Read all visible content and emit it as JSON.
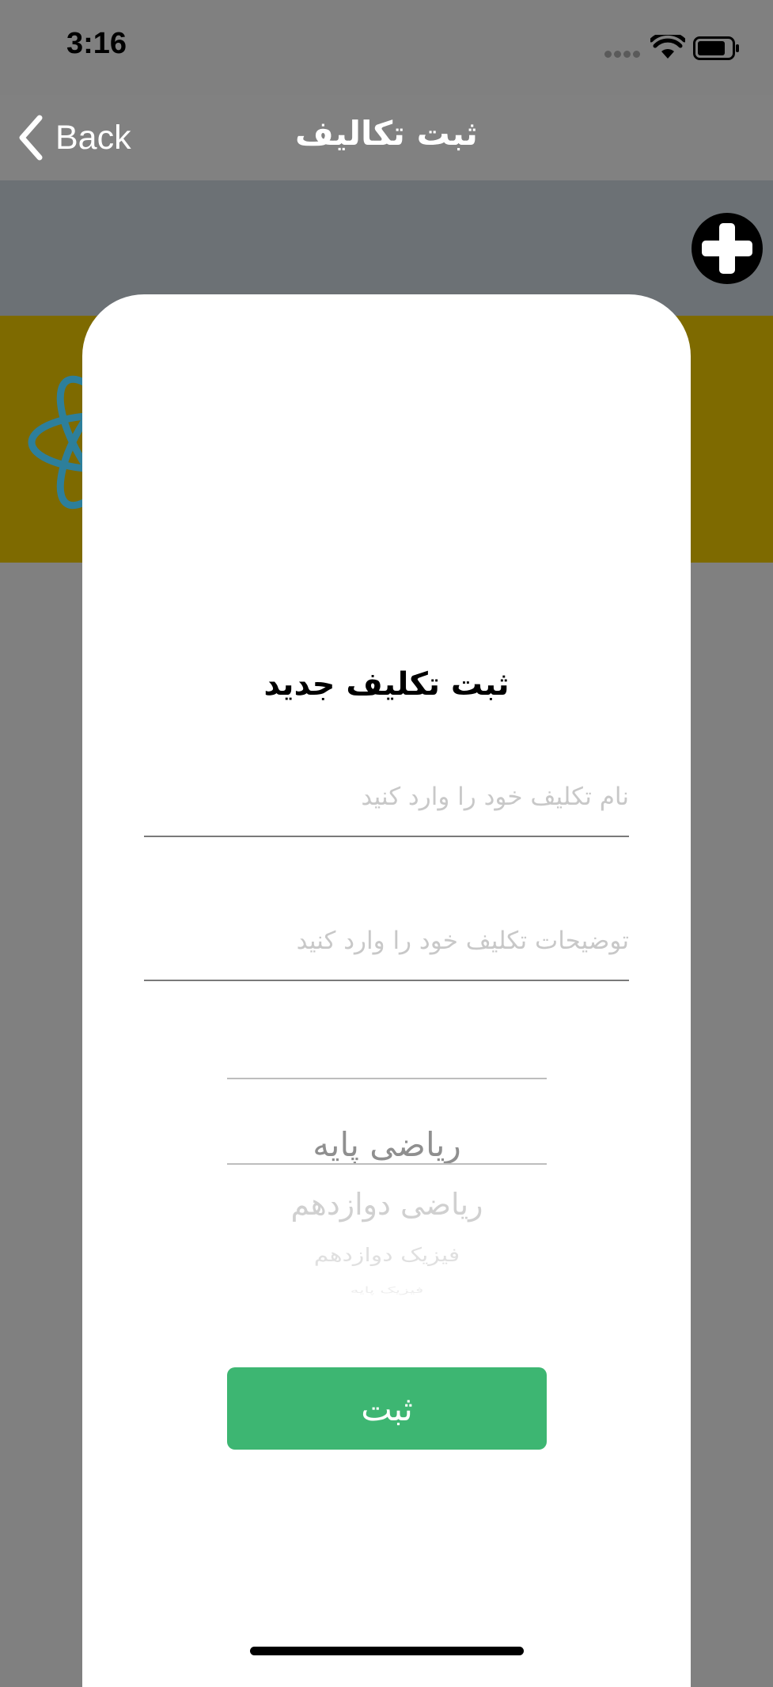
{
  "status_bar": {
    "time": "3:16"
  },
  "nav": {
    "back_label": "Back",
    "title": "ثبت تکالیف"
  },
  "modal": {
    "title": "ثبت تکلیف جدید",
    "name_field": {
      "placeholder": "نام تکلیف خود را وارد کنید",
      "value": ""
    },
    "description_field": {
      "placeholder": "توضیحات تکلیف خود را وارد کنید",
      "value": ""
    },
    "subject_picker": {
      "selected": "ریاضی پایه",
      "options": [
        "ریاضی دوازدهم",
        "فیزیک دوازدهم",
        "فیزیک پایه"
      ]
    },
    "submit_label": "ثبت"
  },
  "colors": {
    "overlay": "#808080",
    "banner": "#7e6a00",
    "submit": "#3db672",
    "toolbar": "#6c7175"
  },
  "icons": [
    "chevron-left-icon",
    "plus-circle-icon",
    "atom-logo-icon",
    "wifi-icon",
    "battery-icon"
  ]
}
